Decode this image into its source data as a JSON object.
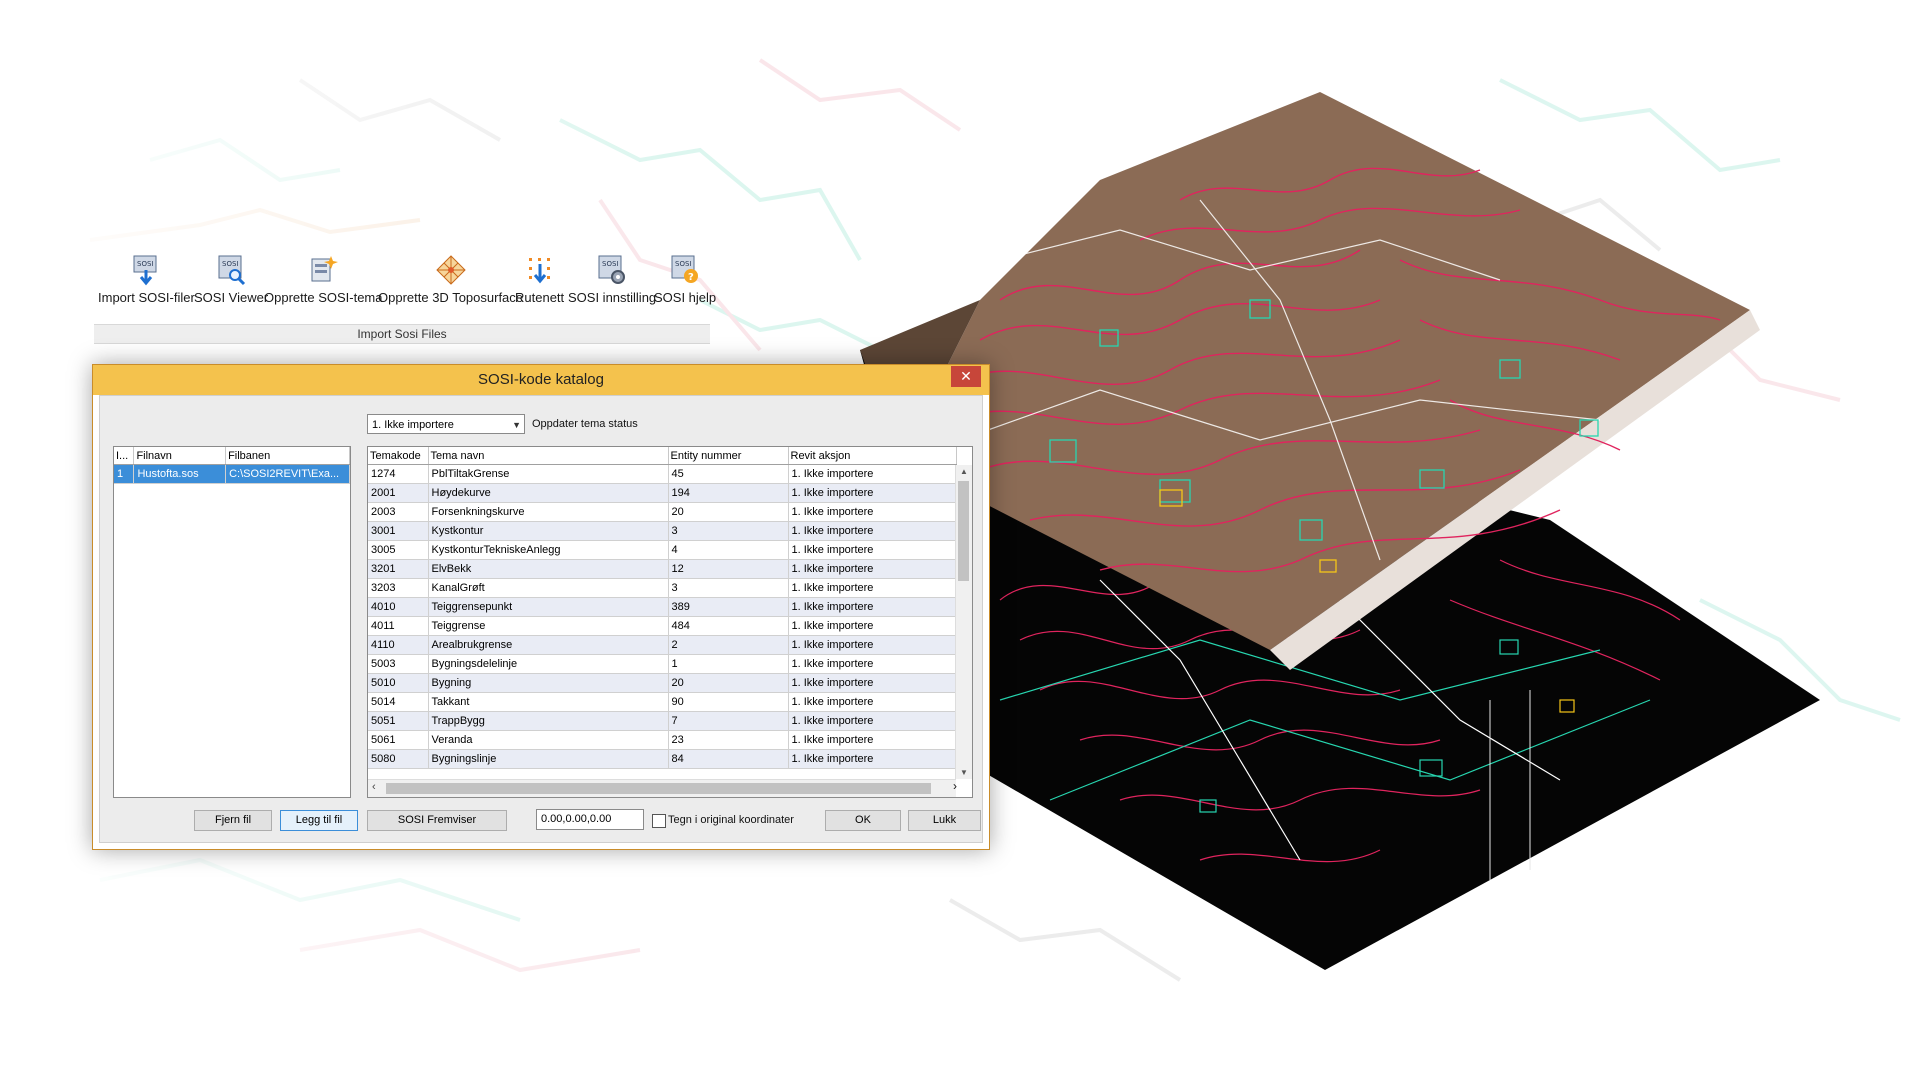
{
  "ribbon": {
    "buttons": [
      {
        "label": "Import SOSI-filer",
        "icon": "import-sosi-icon"
      },
      {
        "label": "SOSI Viewer",
        "icon": "sosi-viewer-icon"
      },
      {
        "label": "Opprette SOSI-tema",
        "icon": "create-theme-icon"
      },
      {
        "label": "Opprette 3D Toposurface",
        "icon": "toposurface-icon"
      },
      {
        "label": "Rutenett",
        "icon": "grid-icon"
      },
      {
        "label": "SOSI innstilling",
        "icon": "settings-icon"
      },
      {
        "label": "SOSI hjelp",
        "icon": "help-icon"
      }
    ],
    "panel_title": "Import Sosi Files"
  },
  "dialog": {
    "title": "SOSI-kode katalog",
    "close_glyph": "✕",
    "status_combo": "1. Ikke importere",
    "status_label": "Oppdater tema status",
    "files": {
      "headers": [
        "I...",
        "Filnavn",
        "Filbanen"
      ],
      "rows": [
        [
          "1",
          "Hustofta.sos",
          "C:\\SOSI2REVIT\\Exa..."
        ]
      ]
    },
    "themes": {
      "headers": [
        "Temakode",
        "Tema navn",
        "Entity nummer",
        "Revit aksjon"
      ],
      "rows": [
        [
          "1274",
          "PblTiltakGrense",
          "45",
          "1. Ikke importere"
        ],
        [
          "2001",
          "Høydekurve",
          "194",
          "1. Ikke importere"
        ],
        [
          "2003",
          "Forsenkningskurve",
          "20",
          "1. Ikke importere"
        ],
        [
          "3001",
          "Kystkontur",
          "3",
          "1. Ikke importere"
        ],
        [
          "3005",
          "KystkonturTekniskeAnlegg",
          "4",
          "1. Ikke importere"
        ],
        [
          "3201",
          "ElvBekk",
          "12",
          "1. Ikke importere"
        ],
        [
          "3203",
          "KanalGrøft",
          "3",
          "1. Ikke importere"
        ],
        [
          "4010",
          "Teiggrensepunkt",
          "389",
          "1. Ikke importere"
        ],
        [
          "4011",
          "Teiggrense",
          "484",
          "1. Ikke importere"
        ],
        [
          "4110",
          "Arealbrukgrense",
          "2",
          "1. Ikke importere"
        ],
        [
          "5003",
          "Bygningsdelelinje",
          "1",
          "1. Ikke importere"
        ],
        [
          "5010",
          "Bygning",
          "20",
          "1. Ikke importere"
        ],
        [
          "5014",
          "Takkant",
          "90",
          "1. Ikke importere"
        ],
        [
          "5051",
          "TrappBygg",
          "7",
          "1. Ikke importere"
        ],
        [
          "5061",
          "Veranda",
          "23",
          "1. Ikke importere"
        ],
        [
          "5080",
          "Bygningslinje",
          "84",
          "1. Ikke importere"
        ]
      ]
    },
    "buttons": {
      "remove": "Fjern fil",
      "add": "Legg til fil",
      "viewer": "SOSI Fremviser",
      "ok": "OK",
      "close": "Lukk"
    },
    "coords_value": "0.00,0.00,0.00",
    "original_coords_label": "Tegn i original koordinater"
  },
  "colors": {
    "title_bar": "#f4c24d",
    "selection": "#3b8ed9",
    "terrain": "#8b6b55",
    "contour": "#e0245e",
    "cyan_lines": "#27d6b0"
  }
}
